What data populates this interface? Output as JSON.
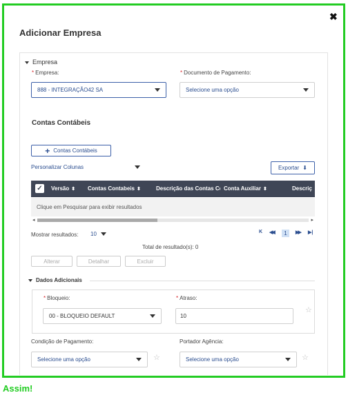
{
  "modal": {
    "title": "Adicionar Empresa",
    "close_glyph": "✖"
  },
  "empresa_section": {
    "title": "Empresa",
    "empresa_label": "Empresa:",
    "empresa_value": "888 - INTEGRAÇÃO42 SA",
    "documento_label": "Documento de Pagamento:",
    "documento_placeholder": "Selecione uma opção"
  },
  "contas": {
    "title": "Contas Contábeis",
    "add_button_label": "Contas Contábeis",
    "personalizar_label": "Personalizar Colunas",
    "exportar_label": "Exportar"
  },
  "table": {
    "columns": [
      "Versão",
      "Contas Contabeis",
      "Descrição das Contas Cc",
      "Conta Auxiliar",
      "Descriç"
    ],
    "empty_message": "Clique em Pesquisar para exibir resultados"
  },
  "pagination": {
    "show_label": "Mostrar resultados:",
    "page_size": "10",
    "total_label": "Total de resultado(s): 0",
    "current_page": "1",
    "first": "K",
    "prev": "◀◀",
    "next": "▶▶",
    "last": "▶|"
  },
  "actions": {
    "alterar": "Alterar",
    "detalhar": "Detalhar",
    "excluir": "Excluir"
  },
  "dados_adicionais": {
    "title": "Dados Adicionais",
    "bloqueio_label": "Bloqueio:",
    "bloqueio_value": "00 - BLOQUEIO DEFAULT",
    "atraso_label": "Atraso:",
    "atraso_value": "10",
    "condicao_label": "Condição de Pagamento:",
    "condicao_placeholder": "Selecione uma opção",
    "portador_label": "Portador Agência:",
    "portador_placeholder": "Selecione uma opção"
  },
  "footer_text": "Assim!",
  "colors": {
    "frame_border": "#22cc22",
    "table_header": "#3f4656",
    "link": "#2a4d8f",
    "required": "#d9262c"
  }
}
